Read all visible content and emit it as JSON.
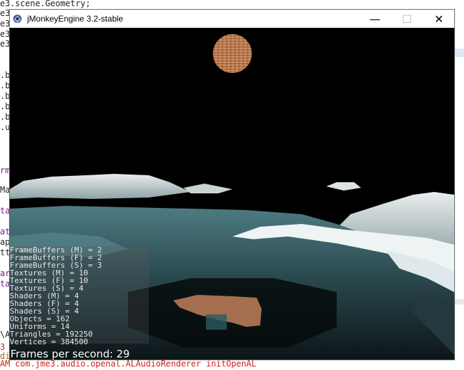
{
  "window": {
    "title": "jMonkeyEngine 3.2-stable",
    "minimize_glyph": "—",
    "maximize_glyph": "☐",
    "close_glyph": "✕"
  },
  "stats": [
    "FrameBuffers (M) = 2",
    "FrameBuffers (F) = 2",
    "FrameBuffers (S) = 3",
    "Textures (M) = 10",
    "Textures (F) = 10",
    "Textures (S) = 4",
    "Shaders (M) = 4",
    "Shaders (F) = 4",
    "Shaders (S) = 4",
    "Objects = 162",
    "Uniforms = 14",
    "Triangles = 192250",
    "Vertices = 384500"
  ],
  "fps": {
    "label": "Frames per second: 29"
  },
  "background_ide": {
    "code_fragments": [
      "e3.scene.Geometry;",
      "e3",
      "e3",
      "e3",
      "e3",
      ".b",
      ".b",
      ".b",
      ".b",
      ".b",
      ".u",
      "rm",
      "Ma",
      "ta",
      "at",
      "ap",
      "tt",
      "ar",
      "ta",
      "\\AP",
      "3",
      "di"
    ],
    "console_line": "AM com.jme3.audio.openal.ALAudioRenderer initOpenAL"
  },
  "colors": {
    "sky": "#000000",
    "moon": "#c98a5e",
    "water": "#3f666c",
    "snow": "#e6eef0"
  }
}
